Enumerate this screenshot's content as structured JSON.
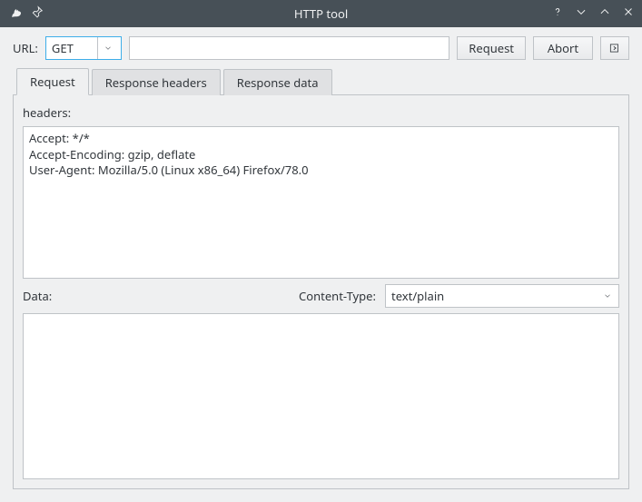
{
  "window": {
    "title": "HTTP tool"
  },
  "url_row": {
    "label": "URL:",
    "method": "GET",
    "url_value": "",
    "request_button": "Request",
    "abort_button": "Abort"
  },
  "tabs": {
    "request": "Request",
    "response_headers": "Response headers",
    "response_data": "Response data"
  },
  "request_panel": {
    "headers_label": "headers:",
    "headers_value": "Accept: */*\nAccept-Encoding: gzip, deflate\nUser-Agent: Mozilla/5.0 (Linux x86_64) Firefox/78.0",
    "data_label": "Data:",
    "content_type_label": "Content-Type:",
    "content_type_value": "text/plain",
    "data_value": ""
  }
}
